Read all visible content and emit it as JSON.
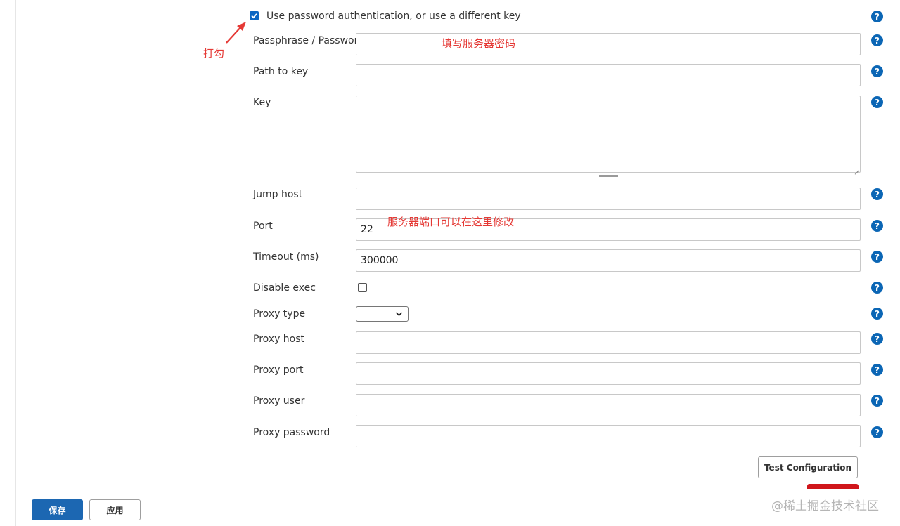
{
  "form": {
    "use_password_label": "Use password authentication, or use a different key",
    "use_password_checked": true,
    "passphrase_label": "Passphrase / Password",
    "passphrase_value": "",
    "path_to_key_label": "Path to key",
    "path_to_key_value": "",
    "key_label": "Key",
    "key_value": "",
    "jump_host_label": "Jump host",
    "jump_host_value": "",
    "port_label": "Port",
    "port_value": "22",
    "timeout_label": "Timeout (ms)",
    "timeout_value": "300000",
    "disable_exec_label": "Disable exec",
    "disable_exec_checked": false,
    "proxy_type_label": "Proxy type",
    "proxy_type_value": "",
    "proxy_host_label": "Proxy host",
    "proxy_port_label": "Proxy port",
    "proxy_user_label": "Proxy user",
    "proxy_password_label": "Proxy password"
  },
  "help_icon": "?",
  "buttons": {
    "test_configuration": "Test Configuration",
    "save": "保存",
    "apply": "应用"
  },
  "annotations": {
    "check_hint": "打勾",
    "password_hint": "填写服务器密码",
    "port_hint": "服务器端口可以在这里修改",
    "color": "#e53935"
  },
  "watermark": "@稀土掘金技术社区",
  "colors": {
    "primary": "#1c67b2",
    "help": "#0b66b5"
  }
}
